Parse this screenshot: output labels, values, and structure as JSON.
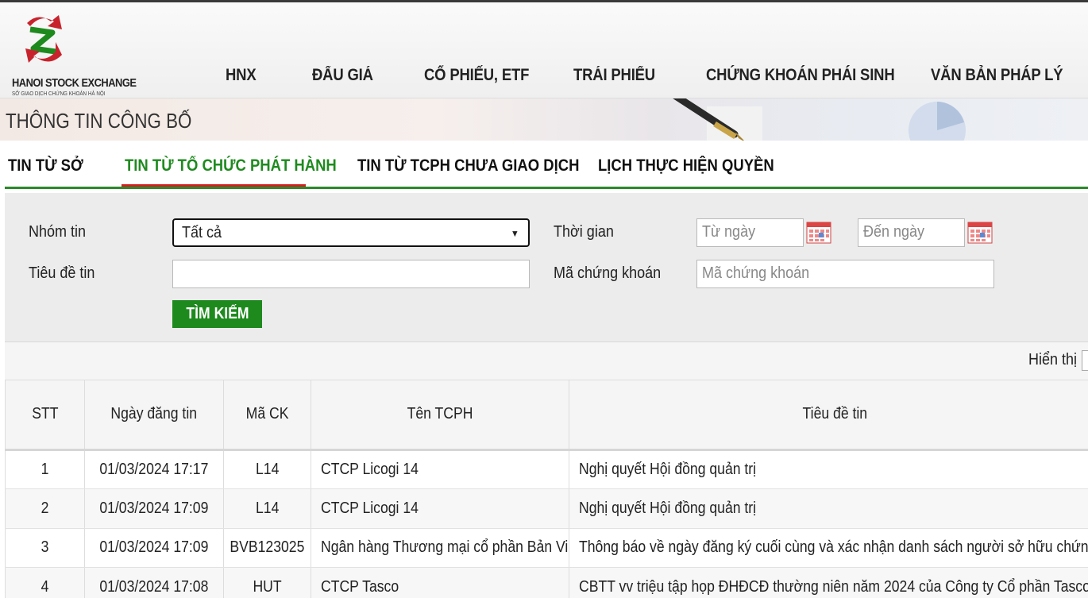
{
  "logo": {
    "name": "HANOI STOCK EXCHANGE",
    "sub": "SỞ GIAO DỊCH CHỨNG KHOÁN HÀ NỘI"
  },
  "nav": [
    "HNX",
    "ĐẤU GIÁ",
    "CỔ PHIẾU, ETF",
    "TRÁI PHIẾU",
    "CHỨNG KHOÁN PHÁI SINH",
    "VĂN BẢN PHÁP LÝ"
  ],
  "banner": {
    "title": "THÔNG TIN CÔNG BỐ"
  },
  "tabs": [
    {
      "label": "TIN TỪ SỞ",
      "active": false
    },
    {
      "label": "TIN TỪ TỔ CHỨC PHÁT HÀNH",
      "active": true
    },
    {
      "label": "TIN TỪ TCPH CHƯA GIAO DỊCH",
      "active": false
    },
    {
      "label": "LỊCH THỰC HIỆN QUYỀN",
      "active": false
    }
  ],
  "search": {
    "group_label": "Nhóm tin",
    "group_value": "Tất cả",
    "time_label": "Thời gian",
    "from_placeholder": "Từ ngày",
    "to_placeholder": "Đến ngày",
    "title_label": "Tiêu đề tin",
    "title_value": "",
    "code_label": "Mã chứng khoán",
    "code_placeholder": "Mã chứng khoán",
    "button": "TÌM KIẾM"
  },
  "display": {
    "label": "Hiển thị"
  },
  "table": {
    "headers": [
      "STT",
      "Ngày đăng tin",
      "Mã CK",
      "Tên TCPH",
      "Tiêu đề tin"
    ],
    "rows": [
      [
        "1",
        "01/03/2024 17:17",
        "L14",
        "CTCP Licogi 14",
        "Nghị quyết Hội đồng quản trị"
      ],
      [
        "2",
        "01/03/2024 17:09",
        "L14",
        "CTCP Licogi 14",
        "Nghị quyết Hội đồng quản trị"
      ],
      [
        "3",
        "01/03/2024 17:09",
        "BVB123025",
        "Ngân hàng Thương mại cổ phần Bản Việt",
        "Thông báo về ngày đăng ký cuối cùng và xác nhận danh sách người sở hữu chứng khoán"
      ],
      [
        "4",
        "01/03/2024 17:08",
        "HUT",
        "CTCP Tasco",
        "CBTT vv triệu tập họp ĐHĐCĐ thường niên năm 2024 của Công ty Cổ phần Tasco"
      ]
    ]
  },
  "colors": {
    "accent_green": "#1e8a1e",
    "active_tab_underline": "#d21f1f"
  }
}
